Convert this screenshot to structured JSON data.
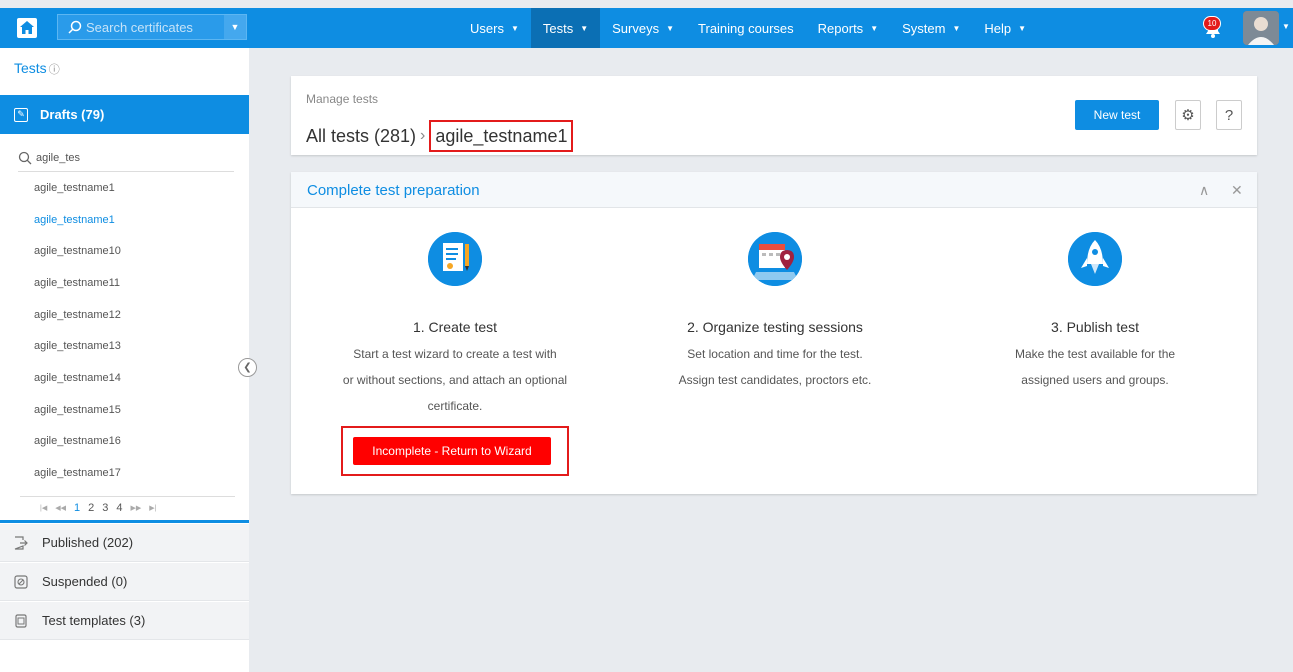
{
  "topbar": {
    "search_placeholder": "Search certificates",
    "nav": [
      {
        "label": "Users",
        "has_caret": true
      },
      {
        "label": "Tests",
        "has_caret": true,
        "active": true
      },
      {
        "label": "Surveys",
        "has_caret": true
      },
      {
        "label": "Training courses",
        "has_caret": false
      },
      {
        "label": "Reports",
        "has_caret": true
      },
      {
        "label": "System",
        "has_caret": true
      },
      {
        "label": "Help",
        "has_caret": true
      }
    ],
    "notification_count": "10",
    "accent_color": "#0e8de2"
  },
  "sidebar": {
    "title": "Tests",
    "drafts_label": "Drafts (79)",
    "search_value": "agile_tes",
    "items": [
      {
        "label": "agile_testname1"
      },
      {
        "label": "agile_testname1"
      },
      {
        "label": "agile_testname10"
      },
      {
        "label": "agile_testname11"
      },
      {
        "label": "agile_testname12"
      },
      {
        "label": "agile_testname13"
      },
      {
        "label": "agile_testname14"
      },
      {
        "label": "agile_testname15"
      },
      {
        "label": "agile_testname16"
      },
      {
        "label": "agile_testname17"
      }
    ],
    "pages": [
      "1",
      "2",
      "3",
      "4"
    ],
    "sections": {
      "published": "Published (202)",
      "suspended": "Suspended (0)",
      "templates": "Test templates (3)"
    }
  },
  "header": {
    "subtitle": "Manage tests",
    "breadcrumb_root": "All tests (281)",
    "breadcrumb_current": "agile_testname1",
    "new_test_label": "New test"
  },
  "prep": {
    "title": "Complete test preparation",
    "steps": [
      {
        "title": "1. Create test",
        "desc": [
          "Start a test wizard to create a test with",
          "or without sections, and attach an optional",
          "certificate."
        ],
        "icon": "document-pencil-icon"
      },
      {
        "title": "2. Organize testing sessions",
        "desc": [
          "Set location and time for the test.",
          "Assign test candidates, proctors etc."
        ],
        "icon": "calendar-location-icon"
      },
      {
        "title": "3. Publish test",
        "desc": [
          "Make the test available for the",
          "assigned users and groups."
        ],
        "icon": "rocket-icon"
      }
    ],
    "wizard_label": "Incomplete - Return to Wizard",
    "alert_color": "#ff0000"
  }
}
